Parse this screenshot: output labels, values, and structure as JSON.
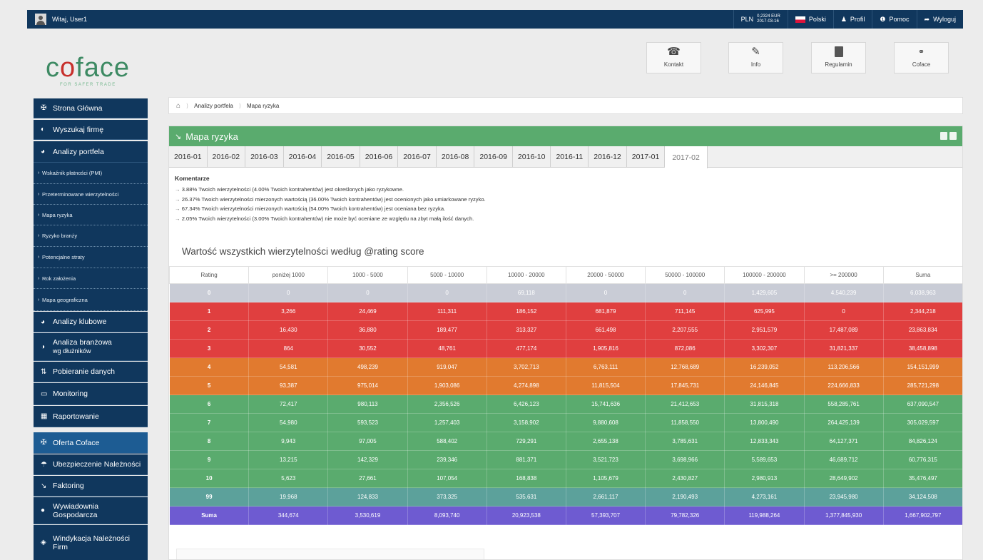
{
  "topbar": {
    "user": "Witaj, User1",
    "currency": "PLN",
    "rate": "0,2324 EUR",
    "rate_date": "2017-03-16",
    "language": "Polski",
    "profile": "Profil",
    "help": "Pomoc",
    "logout": "Wyloguj"
  },
  "logo": {
    "brand_part1": "c",
    "brand_part2": "o",
    "brand_part3": "face",
    "tagline": "FOR SAFER TRADE"
  },
  "header_buttons": [
    {
      "label": "Kontakt",
      "icon": "phone-icon"
    },
    {
      "label": "Info",
      "icon": "pencil-icon"
    },
    {
      "label": "Regulamin",
      "icon": "document-icon"
    },
    {
      "label": "Coface",
      "icon": "link-icon"
    }
  ],
  "sidebar": {
    "main": [
      {
        "label": "Strona Główna",
        "icon": "✠"
      },
      {
        "label": "Wyszukaj firmę",
        "icon": "◐"
      },
      {
        "label": "Analizy portfela",
        "icon": "◕"
      }
    ],
    "sub": [
      "Wskaźnik płatności (PMI)",
      "Przeterminowane wierzytelności",
      "Mapa ryzyka",
      "Ryzyko branży",
      "Potencjalne straty",
      "Rok założenia",
      "Mapa geograficzna"
    ],
    "more": [
      {
        "label": "Analizy klubowe",
        "icon": "◕"
      },
      {
        "label": "Analiza branżowa",
        "label2": "wg dłużników",
        "icon": "◑"
      },
      {
        "label": "Pobieranie danych",
        "icon": "⇅"
      },
      {
        "label": "Monitoring",
        "icon": "▭"
      },
      {
        "label": "Raportowanie",
        "icon": "▦"
      }
    ],
    "offer": {
      "label": "Oferta Coface",
      "icon": "✠"
    },
    "offer_items": [
      {
        "label": "Ubezpieczenie Należności",
        "icon": "☂"
      },
      {
        "label": "Faktoring",
        "icon": "↘"
      },
      {
        "label": "Wywiadownia",
        "label2": "Gospodarcza",
        "icon": "●"
      },
      {
        "label": "Windykacja Należności",
        "label2": "Firm",
        "icon": "◈"
      }
    ]
  },
  "breadcrumb": {
    "section": "Analizy portfela",
    "page": "Mapa ryzyka"
  },
  "panel": {
    "title": "Mapa ryzyka",
    "tabs": [
      "2016-01",
      "2016-02",
      "2016-03",
      "2016-04",
      "2016-05",
      "2016-06",
      "2016-07",
      "2016-08",
      "2016-09",
      "2016-10",
      "2016-11",
      "2016-12",
      "2017-01",
      "2017-02"
    ],
    "active_tab": "2017-02",
    "comments_title": "Komentarze",
    "comments": [
      "3.88% Twoich wierzytelności (4.00% Twoich kontrahentów) jest określonych jako ryzykowne.",
      "26.37% Twoich wierzytelności mierzonych wartością (36.00% Twoich kontrahentów) jest ocenionych jako umiarkowane ryzyko.",
      "67.34% Twoich wierzytelności mierzonych wartością (54.00% Twoich kontrahentów) jest oceniana bez ryzyka.",
      "2.05% Twoich wierzytelności (3.00% Twoich kontrahentów) nie może być oceniane ze względu na zbyt małą ilość danych."
    ],
    "table_title": "Wartość wszystkich wierzytelności według @rating score"
  },
  "table": {
    "headers": [
      "Rating",
      "poniżej 1000",
      "1000 - 5000",
      "5000 - 10000",
      "10000 - 20000",
      "20000 - 50000",
      "50000 - 100000",
      "100000 - 200000",
      ">= 200000",
      "Suma"
    ],
    "rows": [
      {
        "cls": "row-gray",
        "cells": [
          "0",
          "0",
          "0",
          "0",
          "69,118",
          "0",
          "0",
          "1,429,605",
          "4,540,239",
          "6,038,963"
        ]
      },
      {
        "cls": "row-red",
        "cells": [
          "1",
          "3,266",
          "24,469",
          "111,311",
          "186,152",
          "681,879",
          "711,145",
          "625,995",
          "0",
          "2,344,218"
        ]
      },
      {
        "cls": "row-red",
        "cells": [
          "2",
          "16,430",
          "36,880",
          "189,477",
          "313,327",
          "661,498",
          "2,207,555",
          "2,951,579",
          "17,487,089",
          "23,863,834"
        ]
      },
      {
        "cls": "row-red",
        "cells": [
          "3",
          "864",
          "30,552",
          "48,761",
          "477,174",
          "1,905,816",
          "872,086",
          "3,302,307",
          "31,821,337",
          "38,458,898"
        ]
      },
      {
        "cls": "row-orange",
        "cells": [
          "4",
          "54,581",
          "498,239",
          "919,047",
          "3,702,713",
          "6,763,111",
          "12,768,689",
          "16,239,052",
          "113,206,566",
          "154,151,999"
        ]
      },
      {
        "cls": "row-orange",
        "cells": [
          "5",
          "93,387",
          "975,014",
          "1,903,086",
          "4,274,898",
          "11,815,504",
          "17,845,731",
          "24,146,845",
          "224,666,833",
          "285,721,298"
        ]
      },
      {
        "cls": "row-green",
        "cells": [
          "6",
          "72,417",
          "980,113",
          "2,356,526",
          "6,426,123",
          "15,741,636",
          "21,412,653",
          "31,815,318",
          "558,285,761",
          "637,090,547"
        ]
      },
      {
        "cls": "row-green",
        "cells": [
          "7",
          "54,980",
          "593,523",
          "1,257,403",
          "3,158,902",
          "9,880,608",
          "11,858,550",
          "13,800,490",
          "264,425,139",
          "305,029,597"
        ]
      },
      {
        "cls": "row-green",
        "cells": [
          "8",
          "9,943",
          "97,005",
          "588,402",
          "729,291",
          "2,655,138",
          "3,785,631",
          "12,833,343",
          "64,127,371",
          "84,826,124"
        ]
      },
      {
        "cls": "row-green",
        "cells": [
          "9",
          "13,215",
          "142,329",
          "239,346",
          "881,371",
          "3,521,723",
          "3,698,966",
          "5,589,653",
          "46,689,712",
          "60,776,315"
        ]
      },
      {
        "cls": "row-green",
        "cells": [
          "10",
          "5,623",
          "27,661",
          "107,054",
          "168,838",
          "1,105,679",
          "2,430,827",
          "2,980,913",
          "28,649,902",
          "35,476,497"
        ]
      },
      {
        "cls": "row-teal",
        "cells": [
          "99",
          "19,968",
          "124,833",
          "373,325",
          "535,631",
          "2,661,117",
          "2,190,493",
          "4,273,161",
          "23,945,980",
          "34,124,508"
        ]
      },
      {
        "cls": "row-purple",
        "cells": [
          "Suma",
          "344,674",
          "3,530,619",
          "8,093,740",
          "20,923,538",
          "57,393,707",
          "79,782,326",
          "119,988,264",
          "1,377,845,930",
          "1,667,902,797"
        ]
      }
    ]
  },
  "colors": {
    "navy": "#10375d",
    "green": "#5aab6e",
    "red": "#e03f3f",
    "orange": "#e17a2f",
    "teal": "#5ca19b",
    "purple": "#6e5bd1",
    "gray": "#c9ccd6"
  }
}
